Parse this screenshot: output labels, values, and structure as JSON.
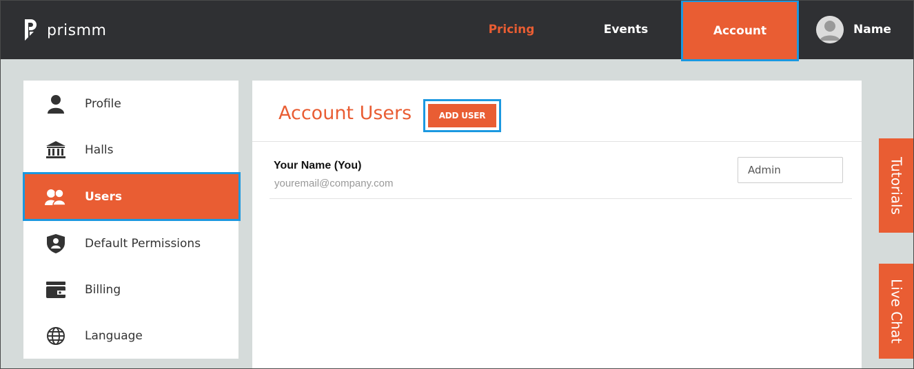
{
  "brand": {
    "name": "prismm",
    "accent": "#e95d33",
    "highlight": "#1b98e0",
    "topbar_bg": "#2f3033"
  },
  "nav": {
    "pricing": "Pricing",
    "events": "Events",
    "account": "Account",
    "user_name": "Name"
  },
  "sidebar": {
    "items": [
      {
        "label": "Profile",
        "icon": "person-icon"
      },
      {
        "label": "Halls",
        "icon": "building-icon"
      },
      {
        "label": "Users",
        "icon": "users-icon",
        "active": true
      },
      {
        "label": "Default Permissions",
        "icon": "shield-icon"
      },
      {
        "label": "Billing",
        "icon": "wallet-icon"
      },
      {
        "label": "Language",
        "icon": "globe-icon"
      }
    ]
  },
  "main": {
    "title": "Account Users",
    "add_user_label": "ADD USER",
    "users": [
      {
        "name": "Your Name (You)",
        "email": "youremail@company.com",
        "role": "Admin"
      }
    ]
  },
  "side_tabs": {
    "tutorials": "Tutorials",
    "live_chat": "Live Chat"
  }
}
